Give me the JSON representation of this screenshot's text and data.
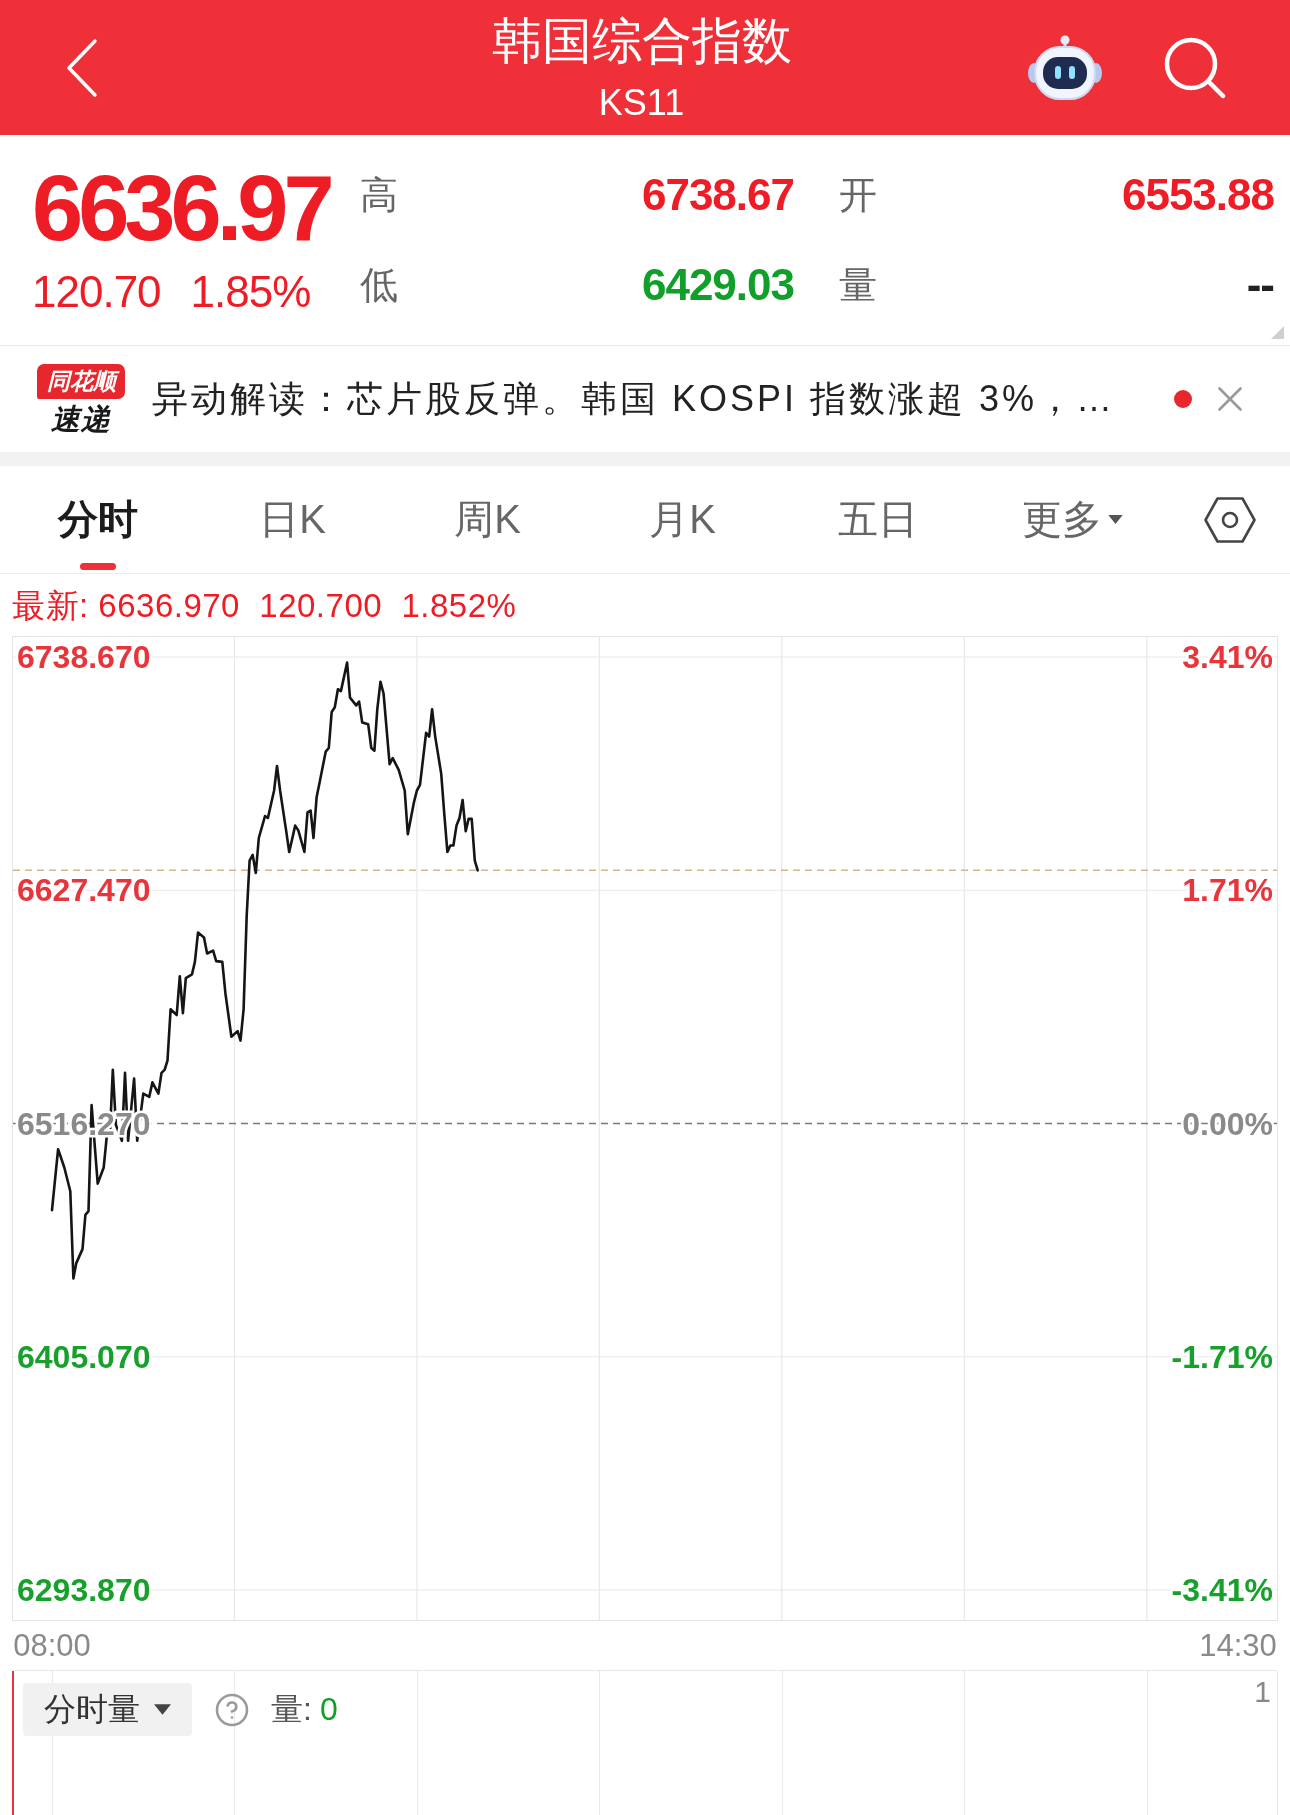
{
  "header": {
    "title": "韩国综合指数",
    "code": "KS11"
  },
  "quote": {
    "price": "6636.97",
    "change": "120.70",
    "percent": "1.85%",
    "rising": true
  },
  "stats": [
    {
      "label": "高",
      "value": "6738.67",
      "color": "#ee1c25"
    },
    {
      "label": "开",
      "value": "6553.88",
      "color": "#ee1c25"
    },
    {
      "label": "低",
      "value": "6429.03",
      "color": "#10a02a"
    },
    {
      "label": "量",
      "value": "--",
      "color": "#222222"
    }
  ],
  "news": {
    "source_tag": "同花顺",
    "source_name": "速递",
    "headline": "异动解读：芯片股反弹。韩国 KOSPI 指数涨超 3%，…",
    "unread": true
  },
  "tabs": [
    {
      "label": "分时",
      "kind": "tab",
      "selected": true
    },
    {
      "label": "日K",
      "kind": "tab",
      "selected": false
    },
    {
      "label": "周K",
      "kind": "tab",
      "selected": false
    },
    {
      "label": "月K",
      "kind": "tab",
      "selected": false
    },
    {
      "label": "五日",
      "kind": "tab",
      "selected": false
    },
    {
      "label": "更多",
      "kind": "menu",
      "selected": false
    }
  ],
  "chart": {
    "latest": "最新: 6636.970  120.700  1.852%",
    "chart_data": {
      "type": "line",
      "x": [
        8,
        8.033,
        8.067,
        8.1,
        8.117,
        8.133,
        8.167,
        8.183,
        8.2,
        8.217,
        8.25,
        8.283,
        8.3,
        8.317,
        8.333,
        8.35,
        8.383,
        8.4,
        8.417,
        8.45,
        8.467,
        8.5,
        8.533,
        8.55,
        8.583,
        8.6,
        8.617,
        8.633,
        8.65,
        8.683,
        8.7,
        8.717,
        8.733,
        8.767,
        8.783,
        8.8,
        8.833,
        8.85,
        8.883,
        8.9,
        8.933,
        8.95,
        8.983,
        9.017,
        9.033,
        9.05,
        9.067,
        9.083,
        9.1,
        9.117,
        9.133,
        9.167,
        9.183,
        9.217,
        9.233,
        9.25,
        9.283,
        9.3,
        9.333,
        9.35,
        9.383,
        9.4,
        9.417,
        9.433,
        9.45,
        9.467,
        9.5,
        9.517,
        9.533,
        9.55,
        9.567,
        9.583,
        9.617,
        9.633,
        9.667,
        9.683,
        9.7,
        9.733,
        9.75,
        9.767,
        9.783,
        9.8,
        9.817,
        9.85,
        9.867,
        9.9,
        9.933,
        9.95,
        9.983,
        10,
        10.017,
        10.05,
        10.067,
        10.083,
        10.1,
        10.133,
        10.15,
        10.167,
        10.183,
        10.2,
        10.217,
        10.233,
        10.25,
        10.267,
        10.283,
        10.3,
        10.317,
        10.333
      ],
      "series": [
        {
          "color": "#151515",
          "values": [
            6475.0,
            6504.0,
            6495.3,
            6484.0,
            6442.4,
            6449.7,
            6456.4,
            6472.7,
            6474.5,
            6525.1,
            6487.6,
            6495.3,
            6510.2,
            6511.0,
            6541.8,
            6515.6,
            6508.0,
            6540.4,
            6508.0,
            6537.7,
            6508.0,
            6530.5,
            6529.0,
            6535.9,
            6530.5,
            6540.4,
            6541.8,
            6546.3,
            6570.7,
            6568.0,
            6586.5,
            6568.9,
            6585.6,
            6587.4,
            6593.3,
            6607.3,
            6605.0,
            6597.3,
            6598.7,
            6593.7,
            6593.3,
            6578.4,
            6557.6,
            6560.3,
            6555.8,
            6570.7,
            6615.4,
            6641.6,
            6644.3,
            6635.7,
            6652.4,
            6662.8,
            6661.9,
            6675.0,
            6686.7,
            6675.0,
            6656.0,
            6645.7,
            6658.3,
            6656.0,
            6645.7,
            6664.6,
            6665.5,
            6652.4,
            6671.8,
            6679.1,
            6693.5,
            6695.3,
            6712.5,
            6714.7,
            6723.3,
            6722.4,
            6736.0,
            6719.3,
            6715.6,
            6717.4,
            6707.5,
            6706.6,
            6695.3,
            6694.0,
            6713.8,
            6726.9,
            6721.1,
            6687.6,
            6690.4,
            6684.9,
            6675.0,
            6654.2,
            6669.1,
            6675.0,
            6677.7,
            6702.5,
            6700.7,
            6713.8,
            6700.7,
            6683.1,
            6663.7,
            6645.7,
            6648.8,
            6648.8,
            6658.3,
            6661.9,
            6670.5,
            6655.6,
            6661.5,
            6661.5,
            6641.6,
            6637.0
          ]
        }
      ],
      "xlim": [
        7.786,
        14.714
      ],
      "ylim": [
        6279.57,
        6748.2
      ],
      "xticks": [
        {
          "value": 8,
          "label": "08:00"
        },
        {
          "value": 14.5,
          "label": "14:30"
        }
      ],
      "yticks": [
        {
          "value": 6738.67,
          "label": "6738.670"
        },
        {
          "value": 6627.47,
          "label": "6627.470"
        },
        {
          "value": 6516.27,
          "label": "6516.270"
        },
        {
          "value": 6405.07,
          "label": "6405.070"
        },
        {
          "value": 6293.87,
          "label": "6293.870"
        }
      ],
      "grid": true,
      "ref_lines": [
        {
          "axis": "y",
          "value": 6636.97,
          "color": "#d9b487"
        },
        {
          "axis": "y",
          "value": 6516.27,
          "color": "#7a7a7a"
        }
      ]
    },
    "percent_labels": [
      {
        "text": "3.41%",
        "color": "#e8353b"
      },
      {
        "text": "1.71%",
        "color": "#e8353b"
      },
      {
        "text": "0.00%",
        "color": "#8a8a8a"
      },
      {
        "text": "-1.71%",
        "color": "#17a02c"
      },
      {
        "text": "-3.41%",
        "color": "#17a02c"
      }
    ]
  },
  "volume": {
    "indicator": "分时量",
    "label": "量:",
    "value": "0",
    "axis_max": "1"
  }
}
